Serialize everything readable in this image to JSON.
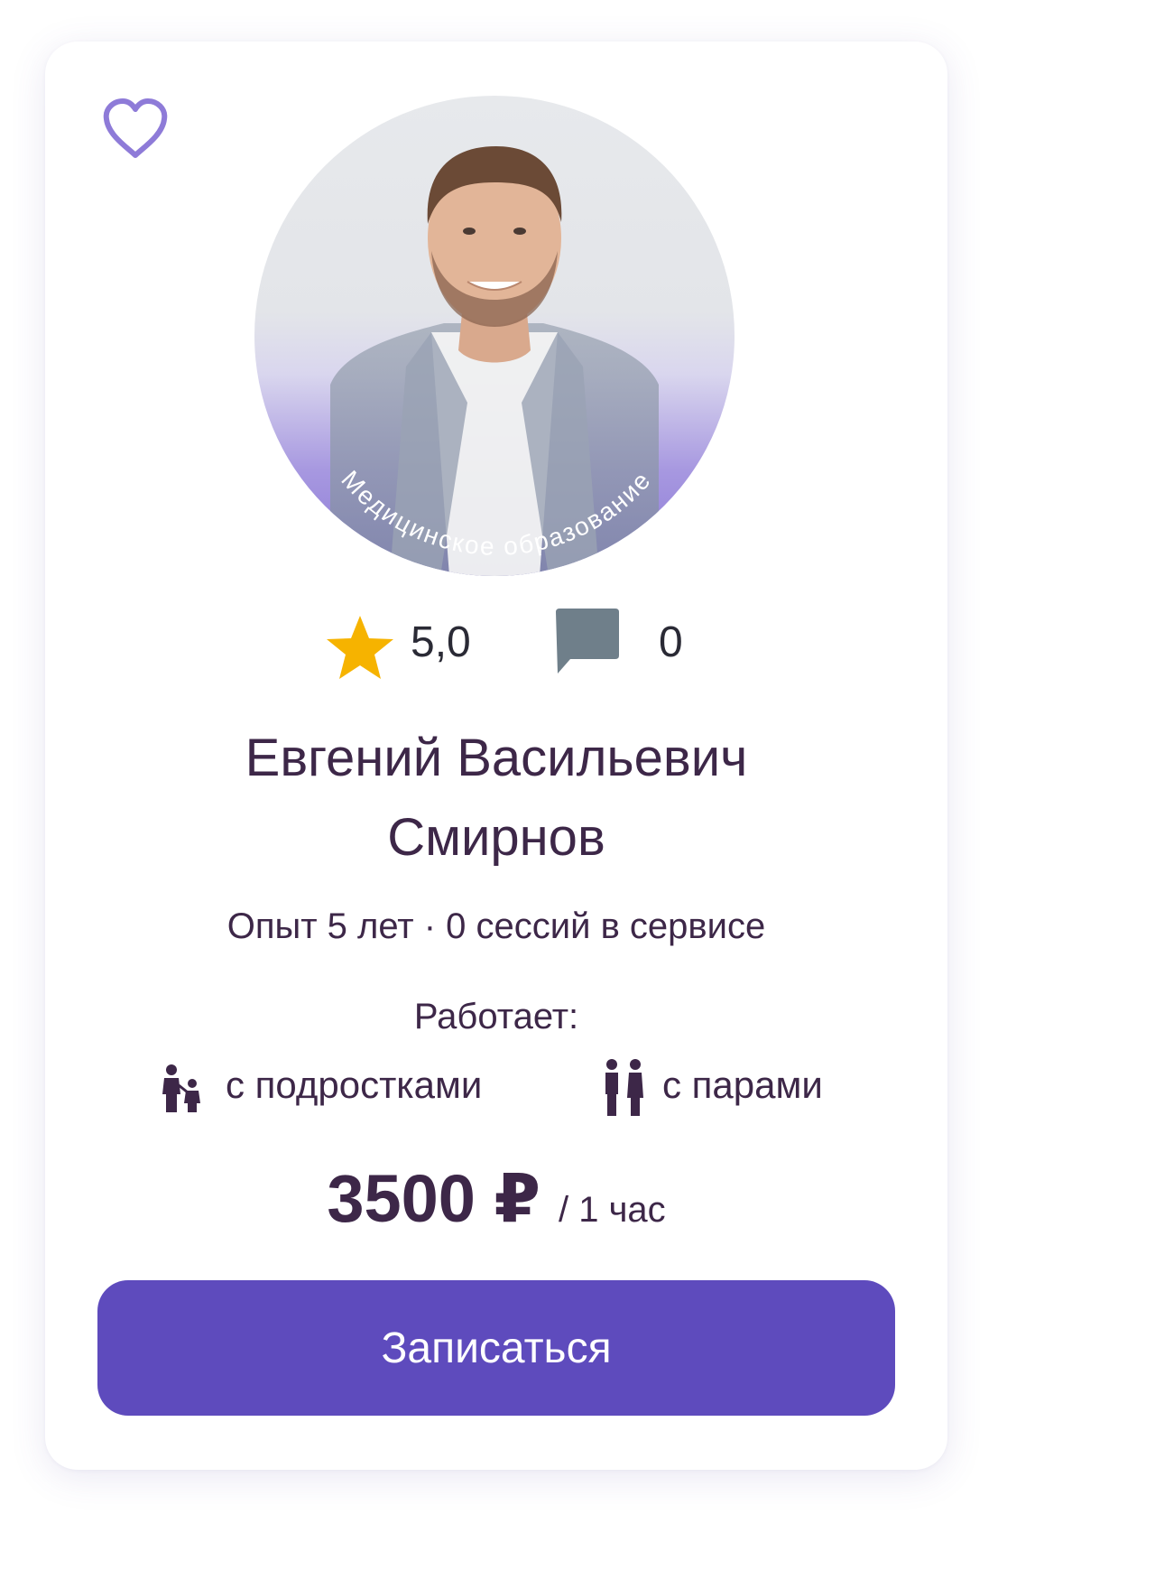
{
  "card": {
    "badge_text": "Медицинское образование",
    "rating": "5,0",
    "reviews_count": "0",
    "name_line1": "Евгений Васильевич",
    "name_line2": "Смирнов",
    "experience": "Опыт 5 лет · 0 сессий в сервисе",
    "works_title": "Работает:",
    "works_with": [
      {
        "label": "с подростками",
        "icon": "parent-teen-icon"
      },
      {
        "label": "с парами",
        "icon": "couple-icon"
      }
    ],
    "price": "3500 ₽",
    "price_unit": "/ 1 час",
    "cta_label": "Записаться"
  },
  "colors": {
    "accent": "#5e4bbd",
    "text": "#3d2748",
    "star": "#f6b300",
    "comment_icon": "#6f7f8a",
    "heart_outline": "#8e7bd8",
    "badge_gradient": "#8a78d6"
  }
}
